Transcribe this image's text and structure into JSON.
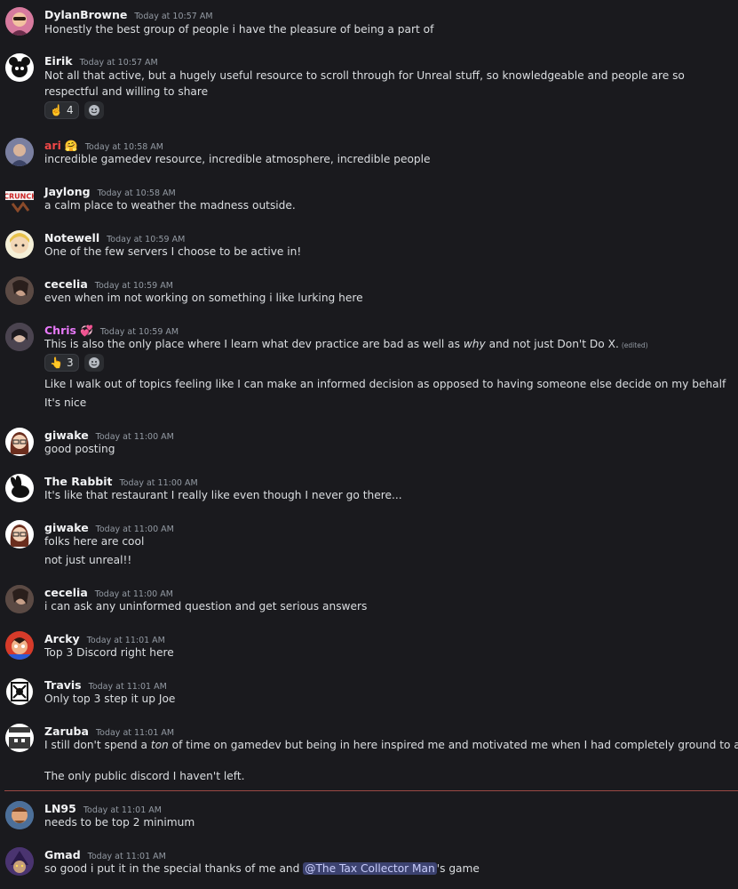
{
  "messages": [
    {
      "user": "DylanBrowne",
      "time": "Today at 10:57 AM",
      "lines": [
        "Honestly the best group of people i have the pleasure of being a part of"
      ]
    },
    {
      "user": "Eirik",
      "time": "Today at 10:57 AM",
      "lines": [
        "Not all that active, but a hugely useful resource to scroll through for Unreal stuff, so knowledgeable and people are so respectful and willing to share"
      ],
      "reaction": {
        "emoji": "☝️",
        "count": "4"
      }
    },
    {
      "user": "ari",
      "badge": "🤗",
      "time": "Today at 10:58 AM",
      "lines": [
        "incredible gamedev resource, incredible atmosphere, incredible people"
      ]
    },
    {
      "user": "Jaylong",
      "time": "Today at 10:58 AM",
      "lines": [
        "a calm place to weather the madness outside."
      ]
    },
    {
      "user": "Notewell",
      "time": "Today at 10:59 AM",
      "lines": [
        "One of the few servers I choose to be active in!"
      ]
    },
    {
      "user": "cecelia",
      "time": "Today at 10:59 AM",
      "lines": [
        "even when im not working on something i like lurking here"
      ]
    },
    {
      "user": "Chris",
      "badge": "💞",
      "time": "Today at 10:59 AM",
      "line1": {
        "a": "This is also the only place where I learn what dev practice are bad as well as ",
        "em": "why",
        "b": " and not just Don't Do X.",
        "edited": "(edited)"
      },
      "reaction": {
        "emoji": "👆",
        "count": "3"
      },
      "lines": [
        "Like I walk out of topics feeling like I can make an informed decision as opposed to having someone else decide on my behalf",
        "It's nice"
      ]
    },
    {
      "user": "giwake",
      "time": "Today at 11:00 AM",
      "lines": [
        "good posting"
      ]
    },
    {
      "user": "The Rabbit",
      "time": "Today at 11:00 AM",
      "lines": [
        "It's like that restaurant I really like even though I never go there..."
      ]
    },
    {
      "user": "giwake",
      "time": "Today at 11:00 AM",
      "lines": [
        "folks here are cool",
        "not just unreal!!"
      ]
    },
    {
      "user": "cecelia",
      "time": "Today at 11:00 AM",
      "lines": [
        "i can ask any uninformed question and get serious answers"
      ]
    },
    {
      "user": "Arcky",
      "time": "Today at 11:01 AM",
      "lines": [
        "Top 3 Discord right here"
      ]
    },
    {
      "user": "Travis",
      "time": "Today at 11:01 AM",
      "lines": [
        "Only top 3 step it up Joe"
      ]
    },
    {
      "user": "Zaruba",
      "time": "Today at 11:01 AM",
      "line1": {
        "a": "I still don't spend a ",
        "em": "ton",
        "b": " of time on gamedev but being in here inspired me and motivated me when I had completely ground to a halt."
      },
      "lines": [
        "The only public discord I haven't left."
      ]
    },
    {
      "user": "LN95",
      "time": "Today at 11:01 AM",
      "lines": [
        "needs to be top 2 minimum"
      ]
    },
    {
      "user": "Gmad",
      "time": "Today at 11:01 AM",
      "line1": {
        "a": "so good i put it in the special thanks of me and ",
        "mention": "@The Tax Collector Man",
        "b": "'s game"
      }
    }
  ],
  "colors": {
    "ari": "#f04747",
    "Chris": "#e879f9",
    "default": "#f2f3f5"
  }
}
